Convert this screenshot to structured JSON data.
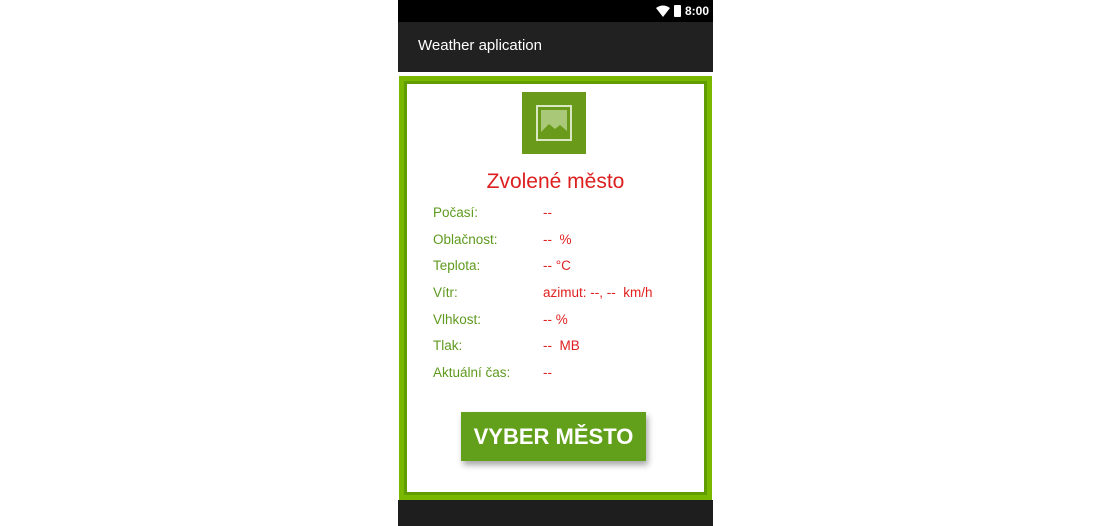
{
  "status_bar": {
    "time": "8:00",
    "icons": [
      "wifi-icon",
      "battery-icon"
    ]
  },
  "app_bar": {
    "title": "Weather aplication"
  },
  "card": {
    "image_icon": "image-placeholder-icon",
    "city_title": "Zvolené město",
    "rows": [
      {
        "label": "Počasí:",
        "value": "--"
      },
      {
        "label": "Oblačnost:",
        "value": "--  %"
      },
      {
        "label": "Teplota:",
        "value": "-- °C"
      },
      {
        "label": "Vítr:",
        "value": "azimut: --, --  km/h"
      },
      {
        "label": "Vlhkost:",
        "value": "-- %"
      },
      {
        "label": "Tlak:",
        "value": "--  MB"
      },
      {
        "label": "Aktuální čas:",
        "value": "--"
      }
    ],
    "button_label": "VYBER MĚSTO"
  },
  "colors": {
    "accent_green": "#62a01c",
    "label_green": "#5f9a1f",
    "value_red": "#e02020",
    "title_red": "#dd1f1f",
    "app_bar": "#212121",
    "status_bar": "#000000"
  }
}
